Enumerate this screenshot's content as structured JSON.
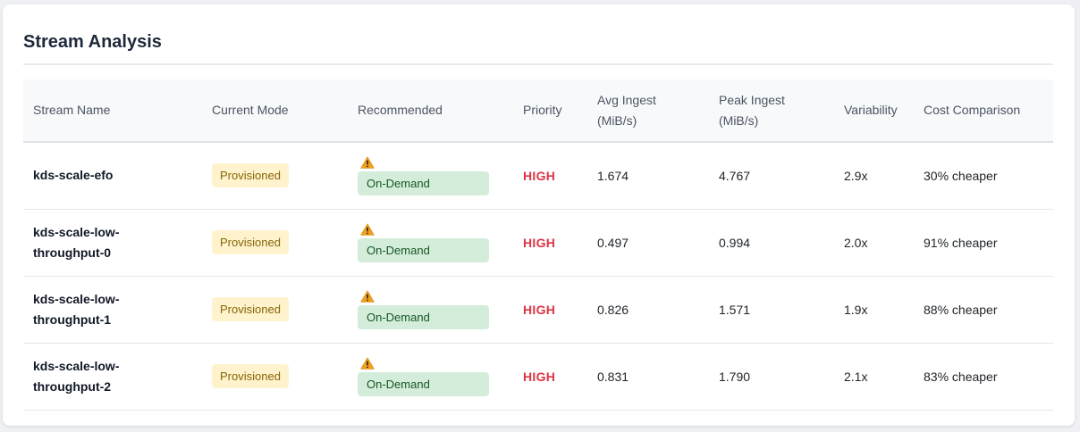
{
  "title": "Stream Analysis",
  "columns": {
    "stream_name": "Stream Name",
    "current_mode": "Current Mode",
    "recommended": "Recommended",
    "priority": "Priority",
    "avg_ingest": "Avg Ingest",
    "avg_ingest_unit": "(MiB/s)",
    "peak_ingest": "Peak Ingest",
    "peak_ingest_unit": "(MiB/s)",
    "variability": "Variability",
    "cost_comparison": "Cost Comparison"
  },
  "rows": [
    {
      "name_line1": "kds-scale-efo",
      "name_line2": "",
      "current_mode": "Provisioned",
      "recommended": "On-Demand",
      "recommended_icon": "warning-icon",
      "priority": "HIGH",
      "avg_ingest": "1.674",
      "peak_ingest": "4.767",
      "variability": "2.9x",
      "cost_comparison": "30% cheaper"
    },
    {
      "name_line1": "kds-scale-low-",
      "name_line2": "throughput-0",
      "current_mode": "Provisioned",
      "recommended": "On-Demand",
      "recommended_icon": "warning-icon",
      "priority": "HIGH",
      "avg_ingest": "0.497",
      "peak_ingest": "0.994",
      "variability": "2.0x",
      "cost_comparison": "91% cheaper"
    },
    {
      "name_line1": "kds-scale-low-",
      "name_line2": "throughput-1",
      "current_mode": "Provisioned",
      "recommended": "On-Demand",
      "recommended_icon": "warning-icon",
      "priority": "HIGH",
      "avg_ingest": "0.826",
      "peak_ingest": "1.571",
      "variability": "1.9x",
      "cost_comparison": "88% cheaper"
    },
    {
      "name_line1": "kds-scale-low-",
      "name_line2": "throughput-2",
      "current_mode": "Provisioned",
      "recommended": "On-Demand",
      "recommended_icon": "warning-icon",
      "priority": "HIGH",
      "avg_ingest": "0.831",
      "peak_ingest": "1.790",
      "variability": "2.1x",
      "cost_comparison": "83% cheaper"
    }
  ],
  "colors": {
    "priority_high": "#dc3545",
    "provisioned_bg": "#fff3cd",
    "provisioned_text": "#856404",
    "ondemand_bg": "#d4edda",
    "ondemand_text": "#155724",
    "warning_icon": "#f0a020"
  }
}
